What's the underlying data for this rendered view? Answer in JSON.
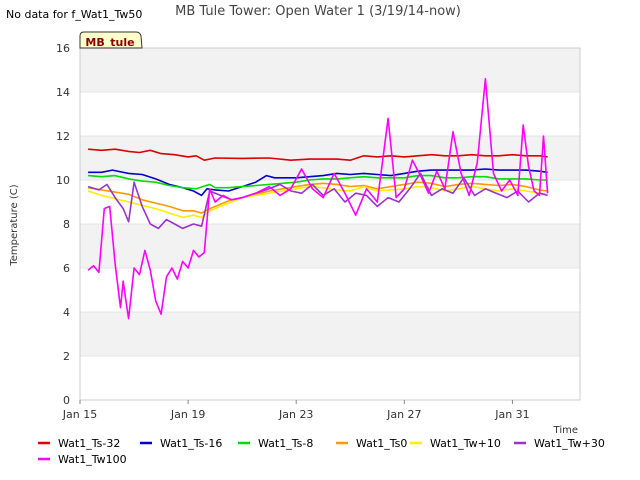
{
  "chart_data": {
    "type": "line",
    "title": "MB Tule Tower: Open Water 1 (3/19/14-now)",
    "no_data_note": "No data for f_Wat1_Tw50",
    "badge": "MB_tule",
    "xlabel": "Time",
    "ylabel": "Temperature (C)",
    "xlim": [
      0,
      18.5
    ],
    "ylim": [
      0,
      16
    ],
    "y_ticks": [
      0,
      2,
      4,
      6,
      8,
      10,
      12,
      14,
      16
    ],
    "x_ticks": [
      {
        "day": 0,
        "label": "Jan 15"
      },
      {
        "day": 4,
        "label": "Jan 19"
      },
      {
        "day": 8,
        "label": "Jan 23"
      },
      {
        "day": 12,
        "label": "Jan 27"
      },
      {
        "day": 16,
        "label": "Jan 31"
      }
    ],
    "grid": "horizontal bands",
    "legend_position": "bottom",
    "series": [
      {
        "name": "Wat1_Ts-32",
        "color": "#dd0000",
        "points": [
          [
            0.3,
            11.4
          ],
          [
            0.8,
            11.35
          ],
          [
            1.3,
            11.4
          ],
          [
            1.8,
            11.3
          ],
          [
            2.2,
            11.25
          ],
          [
            2.6,
            11.35
          ],
          [
            3.0,
            11.2
          ],
          [
            3.5,
            11.15
          ],
          [
            4.0,
            11.05
          ],
          [
            4.3,
            11.1
          ],
          [
            4.6,
            10.9
          ],
          [
            5.0,
            11.0
          ],
          [
            6.0,
            10.98
          ],
          [
            7.0,
            11.0
          ],
          [
            7.8,
            10.9
          ],
          [
            8.5,
            10.95
          ],
          [
            9.5,
            10.95
          ],
          [
            10.0,
            10.9
          ],
          [
            10.5,
            11.1
          ],
          [
            11.0,
            11.05
          ],
          [
            11.5,
            11.1
          ],
          [
            12.0,
            11.05
          ],
          [
            12.5,
            11.1
          ],
          [
            13.0,
            11.15
          ],
          [
            13.5,
            11.1
          ],
          [
            14.0,
            11.1
          ],
          [
            14.5,
            11.15
          ],
          [
            15.0,
            11.1
          ],
          [
            15.5,
            11.1
          ],
          [
            16.0,
            11.15
          ],
          [
            16.5,
            11.1
          ],
          [
            17.0,
            11.1
          ],
          [
            17.3,
            11.05
          ]
        ]
      },
      {
        "name": "Wat1_Ts-16",
        "color": "#0000cc",
        "points": [
          [
            0.3,
            10.35
          ],
          [
            0.8,
            10.35
          ],
          [
            1.2,
            10.45
          ],
          [
            1.8,
            10.3
          ],
          [
            2.3,
            10.25
          ],
          [
            2.8,
            10.05
          ],
          [
            3.3,
            9.8
          ],
          [
            3.8,
            9.65
          ],
          [
            4.2,
            9.5
          ],
          [
            4.5,
            9.3
          ],
          [
            4.7,
            9.6
          ],
          [
            5.0,
            9.55
          ],
          [
            5.5,
            9.5
          ],
          [
            6.0,
            9.7
          ],
          [
            6.5,
            9.9
          ],
          [
            6.9,
            10.2
          ],
          [
            7.2,
            10.1
          ],
          [
            8.0,
            10.1
          ],
          [
            8.5,
            10.15
          ],
          [
            9.0,
            10.2
          ],
          [
            9.5,
            10.3
          ],
          [
            10.0,
            10.25
          ],
          [
            10.5,
            10.3
          ],
          [
            11.0,
            10.25
          ],
          [
            11.5,
            10.2
          ],
          [
            12.0,
            10.3
          ],
          [
            12.5,
            10.4
          ],
          [
            13.0,
            10.45
          ],
          [
            13.5,
            10.45
          ],
          [
            14.0,
            10.45
          ],
          [
            14.5,
            10.45
          ],
          [
            15.0,
            10.5
          ],
          [
            15.5,
            10.45
          ],
          [
            16.0,
            10.45
          ],
          [
            16.5,
            10.45
          ],
          [
            17.0,
            10.4
          ],
          [
            17.3,
            10.35
          ]
        ]
      },
      {
        "name": "Wat1_Ts-8",
        "color": "#00dd00",
        "points": [
          [
            0.3,
            10.2
          ],
          [
            0.8,
            10.15
          ],
          [
            1.3,
            10.2
          ],
          [
            1.8,
            10.05
          ],
          [
            2.3,
            9.95
          ],
          [
            2.8,
            9.9
          ],
          [
            3.3,
            9.75
          ],
          [
            3.8,
            9.65
          ],
          [
            4.3,
            9.6
          ],
          [
            4.8,
            9.8
          ],
          [
            5.0,
            9.65
          ],
          [
            5.5,
            9.65
          ],
          [
            6.0,
            9.7
          ],
          [
            6.5,
            9.75
          ],
          [
            7.0,
            9.8
          ],
          [
            7.5,
            9.85
          ],
          [
            8.0,
            9.9
          ],
          [
            8.5,
            10.0
          ],
          [
            9.0,
            10.05
          ],
          [
            9.5,
            10.05
          ],
          [
            10.0,
            10.1
          ],
          [
            10.5,
            10.15
          ],
          [
            11.0,
            10.1
          ],
          [
            11.5,
            10.1
          ],
          [
            12.0,
            10.1
          ],
          [
            12.5,
            10.2
          ],
          [
            13.0,
            10.2
          ],
          [
            13.5,
            10.1
          ],
          [
            14.0,
            10.1
          ],
          [
            14.5,
            10.15
          ],
          [
            15.0,
            10.15
          ],
          [
            15.5,
            10.05
          ],
          [
            16.0,
            10.05
          ],
          [
            16.5,
            10.05
          ],
          [
            17.0,
            10.0
          ],
          [
            17.3,
            10.0
          ]
        ]
      },
      {
        "name": "Wat1_Ts0",
        "color": "#ff9900",
        "points": [
          [
            0.3,
            9.65
          ],
          [
            0.8,
            9.55
          ],
          [
            1.3,
            9.45
          ],
          [
            1.8,
            9.35
          ],
          [
            2.3,
            9.1
          ],
          [
            2.8,
            8.95
          ],
          [
            3.3,
            8.8
          ],
          [
            3.8,
            8.6
          ],
          [
            4.2,
            8.6
          ],
          [
            4.5,
            8.5
          ],
          [
            4.8,
            8.7
          ],
          [
            5.2,
            8.9
          ],
          [
            5.6,
            9.1
          ],
          [
            6.0,
            9.2
          ],
          [
            6.5,
            9.35
          ],
          [
            7.0,
            9.5
          ],
          [
            7.5,
            9.6
          ],
          [
            8.0,
            9.7
          ],
          [
            8.5,
            9.8
          ],
          [
            9.0,
            9.85
          ],
          [
            9.5,
            9.8
          ],
          [
            10.0,
            9.7
          ],
          [
            10.5,
            9.75
          ],
          [
            11.0,
            9.6
          ],
          [
            11.5,
            9.7
          ],
          [
            12.0,
            9.8
          ],
          [
            12.5,
            9.9
          ],
          [
            13.0,
            9.85
          ],
          [
            13.5,
            9.7
          ],
          [
            14.0,
            9.8
          ],
          [
            14.5,
            9.85
          ],
          [
            15.0,
            9.8
          ],
          [
            15.5,
            9.75
          ],
          [
            16.0,
            9.8
          ],
          [
            16.5,
            9.7
          ],
          [
            17.0,
            9.55
          ],
          [
            17.3,
            9.5
          ]
        ]
      },
      {
        "name": "Wat1_Tw+10",
        "color": "#ffee00",
        "points": [
          [
            0.3,
            9.5
          ],
          [
            0.8,
            9.3
          ],
          [
            1.3,
            9.15
          ],
          [
            1.8,
            9.0
          ],
          [
            2.3,
            8.85
          ],
          [
            2.8,
            8.7
          ],
          [
            3.3,
            8.5
          ],
          [
            3.8,
            8.3
          ],
          [
            4.2,
            8.4
          ],
          [
            4.5,
            8.3
          ],
          [
            4.8,
            8.6
          ],
          [
            5.2,
            8.8
          ],
          [
            5.6,
            9.0
          ],
          [
            6.0,
            9.2
          ],
          [
            6.5,
            9.3
          ],
          [
            7.0,
            9.4
          ],
          [
            7.5,
            9.5
          ],
          [
            8.0,
            9.6
          ],
          [
            8.5,
            9.7
          ],
          [
            9.0,
            9.65
          ],
          [
            9.5,
            9.55
          ],
          [
            10.0,
            9.5
          ],
          [
            10.5,
            9.7
          ],
          [
            11.0,
            9.5
          ],
          [
            11.5,
            9.55
          ],
          [
            12.0,
            9.6
          ],
          [
            12.5,
            9.7
          ],
          [
            13.0,
            9.65
          ],
          [
            13.5,
            9.5
          ],
          [
            14.0,
            9.6
          ],
          [
            14.5,
            9.7
          ],
          [
            15.0,
            9.6
          ],
          [
            15.5,
            9.5
          ],
          [
            16.0,
            9.6
          ],
          [
            16.5,
            9.5
          ],
          [
            17.0,
            9.4
          ],
          [
            17.3,
            9.35
          ]
        ]
      },
      {
        "name": "Wat1_Tw+30",
        "color": "#9933cc",
        "points": [
          [
            0.3,
            9.7
          ],
          [
            0.7,
            9.55
          ],
          [
            1.0,
            9.8
          ],
          [
            1.3,
            9.2
          ],
          [
            1.6,
            8.7
          ],
          [
            1.8,
            8.1
          ],
          [
            2.0,
            9.9
          ],
          [
            2.3,
            8.8
          ],
          [
            2.6,
            8.0
          ],
          [
            2.9,
            7.8
          ],
          [
            3.2,
            8.2
          ],
          [
            3.5,
            8.0
          ],
          [
            3.8,
            7.8
          ],
          [
            4.2,
            8.0
          ],
          [
            4.5,
            7.9
          ],
          [
            4.8,
            9.5
          ],
          [
            5.2,
            9.3
          ],
          [
            5.6,
            9.1
          ],
          [
            6.0,
            9.2
          ],
          [
            6.5,
            9.4
          ],
          [
            7.0,
            9.6
          ],
          [
            7.4,
            9.8
          ],
          [
            7.8,
            9.5
          ],
          [
            8.2,
            9.4
          ],
          [
            8.6,
            9.8
          ],
          [
            9.0,
            9.3
          ],
          [
            9.4,
            9.6
          ],
          [
            9.8,
            9.0
          ],
          [
            10.2,
            9.4
          ],
          [
            10.6,
            9.3
          ],
          [
            11.0,
            8.8
          ],
          [
            11.4,
            9.2
          ],
          [
            11.8,
            9.0
          ],
          [
            12.2,
            9.6
          ],
          [
            12.6,
            10.3
          ],
          [
            13.0,
            9.3
          ],
          [
            13.4,
            9.6
          ],
          [
            13.8,
            9.4
          ],
          [
            14.2,
            10.1
          ],
          [
            14.6,
            9.3
          ],
          [
            15.0,
            9.6
          ],
          [
            15.4,
            9.4
          ],
          [
            15.8,
            9.2
          ],
          [
            16.2,
            9.5
          ],
          [
            16.6,
            9.0
          ],
          [
            17.0,
            9.4
          ],
          [
            17.3,
            9.3
          ]
        ]
      },
      {
        "name": "Wat1_Tw100",
        "color": "#ff00ff",
        "points": [
          [
            0.3,
            5.9
          ],
          [
            0.5,
            6.1
          ],
          [
            0.7,
            5.8
          ],
          [
            0.9,
            8.7
          ],
          [
            1.1,
            8.8
          ],
          [
            1.3,
            6.2
          ],
          [
            1.5,
            4.2
          ],
          [
            1.6,
            5.4
          ],
          [
            1.7,
            4.5
          ],
          [
            1.8,
            3.7
          ],
          [
            2.0,
            6.0
          ],
          [
            2.2,
            5.7
          ],
          [
            2.4,
            6.8
          ],
          [
            2.6,
            5.9
          ],
          [
            2.8,
            4.5
          ],
          [
            3.0,
            3.9
          ],
          [
            3.2,
            5.6
          ],
          [
            3.4,
            6.0
          ],
          [
            3.6,
            5.5
          ],
          [
            3.8,
            6.3
          ],
          [
            4.0,
            6.0
          ],
          [
            4.2,
            6.8
          ],
          [
            4.4,
            6.5
          ],
          [
            4.6,
            6.7
          ],
          [
            4.8,
            9.6
          ],
          [
            5.0,
            9.0
          ],
          [
            5.3,
            9.3
          ],
          [
            5.6,
            9.1
          ],
          [
            6.0,
            9.2
          ],
          [
            6.5,
            9.4
          ],
          [
            7.0,
            9.7
          ],
          [
            7.4,
            9.3
          ],
          [
            7.8,
            9.6
          ],
          [
            8.2,
            10.5
          ],
          [
            8.6,
            9.6
          ],
          [
            9.0,
            9.2
          ],
          [
            9.4,
            10.3
          ],
          [
            9.8,
            9.4
          ],
          [
            10.2,
            8.4
          ],
          [
            10.6,
            9.6
          ],
          [
            11.0,
            9.0
          ],
          [
            11.4,
            12.8
          ],
          [
            11.7,
            9.2
          ],
          [
            12.0,
            9.6
          ],
          [
            12.3,
            10.9
          ],
          [
            12.6,
            10.2
          ],
          [
            12.9,
            9.4
          ],
          [
            13.2,
            10.4
          ],
          [
            13.5,
            9.6
          ],
          [
            13.8,
            12.2
          ],
          [
            14.1,
            10.3
          ],
          [
            14.4,
            9.3
          ],
          [
            14.7,
            10.8
          ],
          [
            15.0,
            14.6
          ],
          [
            15.3,
            10.3
          ],
          [
            15.6,
            9.5
          ],
          [
            15.9,
            10.0
          ],
          [
            16.2,
            9.3
          ],
          [
            16.4,
            12.5
          ],
          [
            16.6,
            10.6
          ],
          [
            16.8,
            9.5
          ],
          [
            17.0,
            9.3
          ],
          [
            17.15,
            12.0
          ],
          [
            17.3,
            9.4
          ]
        ]
      }
    ]
  }
}
